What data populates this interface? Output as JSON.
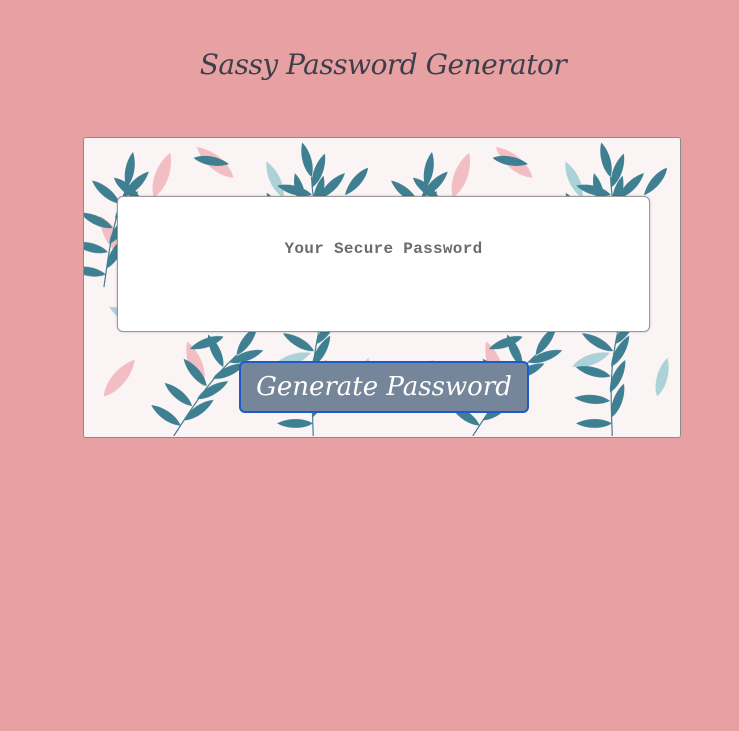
{
  "header": {
    "title": "Sassy Password Generator"
  },
  "card": {
    "password_placeholder": "Your Secure Password",
    "generate_label": "Generate Password",
    "pattern": "botanical-leaf-pattern"
  },
  "colors": {
    "page_background": "#e8a1a2",
    "title_text": "#3c3f4a",
    "button_background": "#76869a",
    "button_border": "#1e5bc8",
    "leaf_teal": "#3f7f92",
    "leaf_light_teal": "#9ccdd3",
    "leaf_pink": "#f2b8be"
  }
}
